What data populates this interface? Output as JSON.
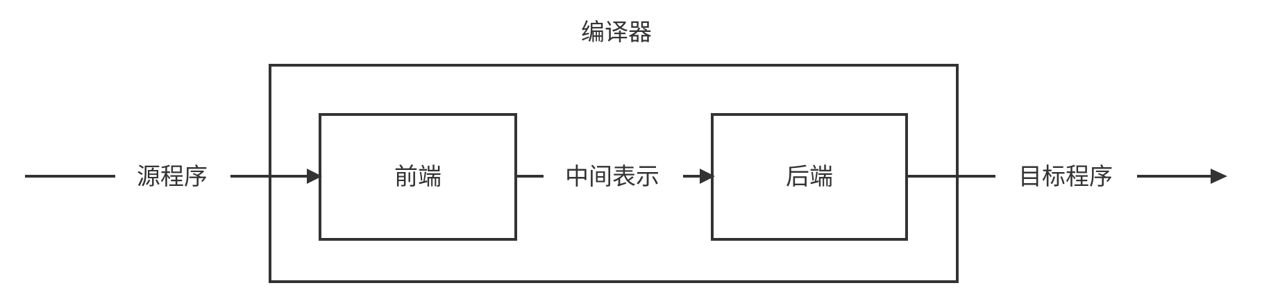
{
  "diagram": {
    "container_label": "编译器",
    "input_label": "源程序",
    "frontend_label": "前端",
    "intermediate_label": "中间表示",
    "backend_label": "后端",
    "output_label": "目标程序"
  }
}
